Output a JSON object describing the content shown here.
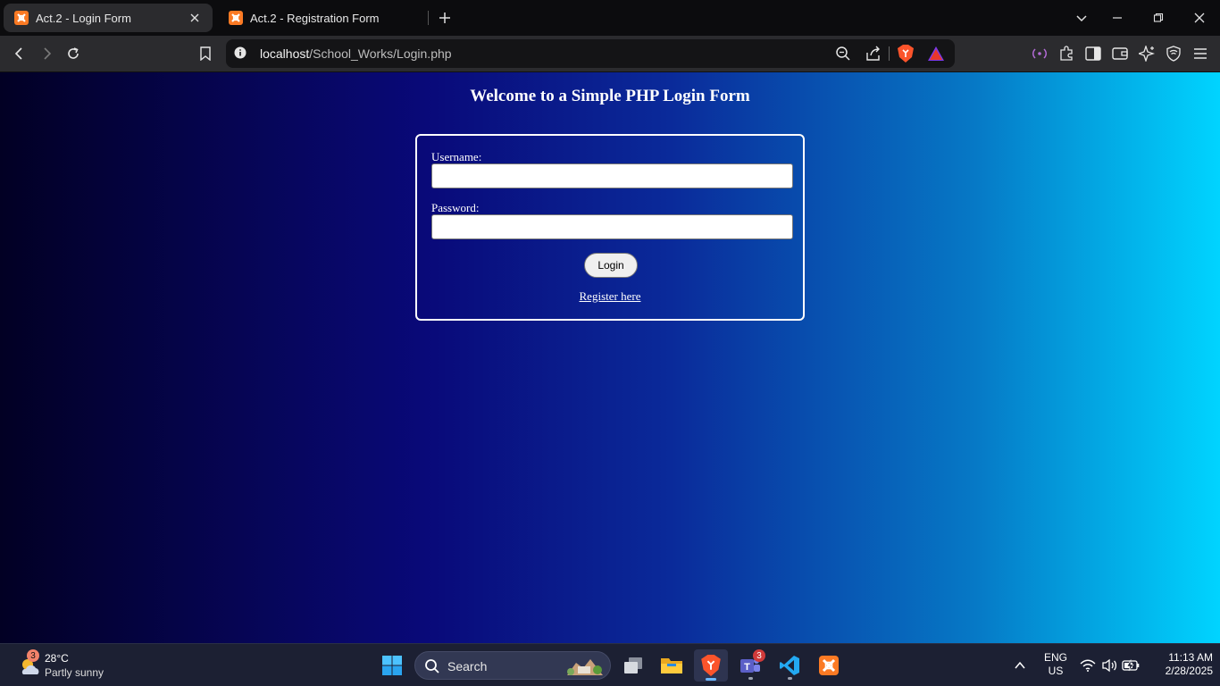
{
  "browser": {
    "tabs": [
      {
        "title": "Act.2 - Login Form",
        "active": true
      },
      {
        "title": "Act.2 - Registration Form",
        "active": false
      }
    ],
    "address": {
      "host": "localhost",
      "path": "/School_Works/Login.php"
    }
  },
  "page": {
    "heading": "Welcome to a Simple PHP Login Form",
    "form": {
      "username_label": "Username:",
      "username_value": "",
      "password_label": "Password:",
      "password_value": "",
      "login_label": "Login",
      "register_label": "Register here"
    },
    "colors": {
      "gradient_start": "#020024",
      "gradient_mid": "#090979",
      "gradient_end": "#00d4ff"
    }
  },
  "taskbar": {
    "weather": {
      "badge": "3",
      "temp": "28°C",
      "condition": "Partly sunny"
    },
    "search_label": "Search",
    "teams_badge": "3",
    "lang_line1": "ENG",
    "lang_line2": "US",
    "time": "11:13 AM",
    "date": "2/28/2025"
  }
}
